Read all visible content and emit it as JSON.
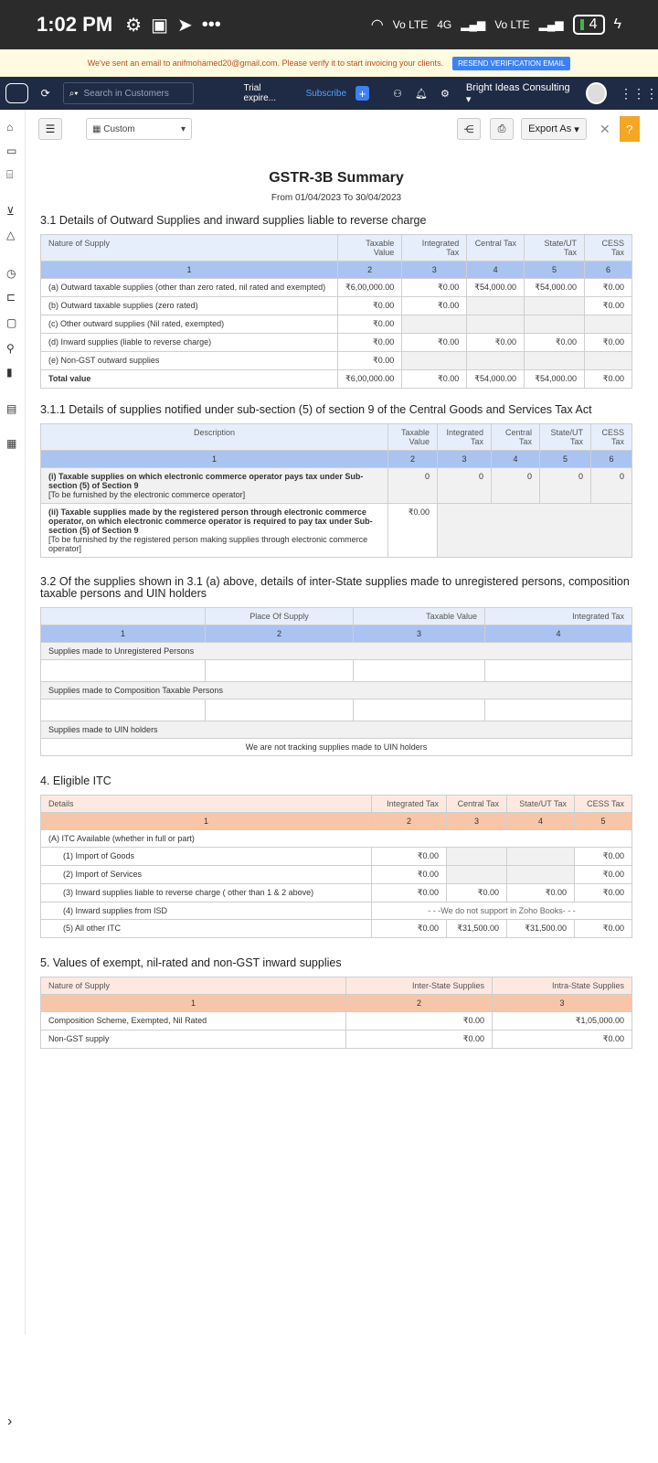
{
  "status": {
    "time": "1:02 PM",
    "network": "4G",
    "lte1": "Vo LTE",
    "lte2": "Vo LTE",
    "battery": "4"
  },
  "banner": {
    "message": "We've sent an email to anifmohamed20@gmail.com. Please verify it to start invoicing your clients.",
    "button": "RESEND VERIFICATION EMAIL"
  },
  "topnav": {
    "search_placeholder": "Search in Customers",
    "trial": "Trial expire...",
    "subscribe": "Subscribe",
    "org": "Bright Ideas Consulting"
  },
  "toolbar": {
    "range": "Custom",
    "export": "Export As",
    "help": "?"
  },
  "report": {
    "title": "GSTR-3B Summary",
    "period": "From 01/04/2023  To 30/04/2023"
  },
  "s31": {
    "heading": "3.1 Details of Outward Supplies and inward supplies liable to reverse charge",
    "cols": [
      "Nature of Supply",
      "Taxable Value",
      "Integrated Tax",
      "Central Tax",
      "State/UT Tax",
      "CESS Tax"
    ],
    "nums": [
      "1",
      "2",
      "3",
      "4",
      "5",
      "6"
    ],
    "rows": [
      [
        "(a) Outward taxable supplies (other than zero rated, nil rated and exempted)",
        "₹6,00,000.00",
        "₹0.00",
        "₹54,000.00",
        "₹54,000.00",
        "₹0.00"
      ],
      [
        "(b) Outward taxable supplies (zero rated)",
        "₹0.00",
        "₹0.00",
        "",
        "",
        "₹0.00"
      ],
      [
        "(c) Other outward supplies (Nil rated, exempted)",
        "₹0.00",
        "",
        "",
        "",
        ""
      ],
      [
        "(d) Inward supplies (liable to reverse charge)",
        "₹0.00",
        "₹0.00",
        "₹0.00",
        "₹0.00",
        "₹0.00"
      ],
      [
        "(e) Non-GST outward supplies",
        "₹0.00",
        "",
        "",
        "",
        ""
      ],
      [
        "Total value",
        "₹6,00,000.00",
        "₹0.00",
        "₹54,000.00",
        "₹54,000.00",
        "₹0.00"
      ]
    ]
  },
  "s311": {
    "heading": "3.1.1 Details of supplies notified under sub-section (5) of section 9 of the Central Goods and Services Tax Act",
    "cols": [
      "Description",
      "Taxable Value",
      "Integrated Tax",
      "Central Tax",
      "State/UT Tax",
      "CESS Tax"
    ],
    "nums": [
      "1",
      "2",
      "3",
      "4",
      "5",
      "6"
    ],
    "r1a": "(i) Taxable supplies on which electronic commerce operator pays tax under Sub-section (5) of Section 9",
    "r1b": "[To be furnished by the electronic commerce operator]",
    "r1v": [
      "0",
      "0",
      "0",
      "0",
      "0"
    ],
    "r2a": "(ii) Taxable supplies made by the registered person through electronic commerce operator, on which electronic commerce operator is required to pay tax under Sub-section (5) of Section 9",
    "r2b": "[To be furnished by the registered person making supplies through electronic commerce operator]",
    "r2v": "₹0.00"
  },
  "s32": {
    "heading": "3.2 Of the supplies shown in 3.1 (a) above, details of inter-State supplies made to unregistered persons, composition taxable persons and UIN holders",
    "cols": [
      "",
      "Place Of Supply",
      "Taxable Value",
      "Integrated Tax"
    ],
    "nums": [
      "1",
      "2",
      "3",
      "4"
    ],
    "g1": "Supplies made to Unregistered Persons",
    "g2": "Supplies made to Composition Taxable Persons",
    "g3": "Supplies made to UIN holders",
    "note": "We are not tracking supplies made to UIN holders"
  },
  "s4": {
    "heading": "4. Eligible ITC",
    "cols": [
      "Details",
      "Integrated Tax",
      "Central Tax",
      "State/UT Tax",
      "CESS Tax"
    ],
    "nums": [
      "1",
      "2",
      "3",
      "4",
      "5"
    ],
    "group": "(A) ITC Available (whether in full or part)",
    "rows": [
      [
        "(1) Import of Goods",
        "₹0.00",
        "",
        "",
        "₹0.00"
      ],
      [
        "(2) Import of Services",
        "₹0.00",
        "",
        "",
        "₹0.00"
      ],
      [
        "(3) Inward supplies liable to reverse charge ( other than 1 & 2 above)",
        "₹0.00",
        "₹0.00",
        "₹0.00",
        "₹0.00"
      ],
      [
        "(5) All other ITC",
        "₹0.00",
        "₹31,500.00",
        "₹31,500.00",
        "₹0.00"
      ]
    ],
    "isd_label": "(4) Inward supplies from ISD",
    "isd_note": "- - -We do not support in Zoho Books- - -"
  },
  "s5": {
    "heading": "5. Values of exempt, nil-rated and non-GST inward supplies",
    "cols": [
      "Nature of Supply",
      "Inter-State Supplies",
      "Intra-State Supplies"
    ],
    "nums": [
      "1",
      "2",
      "3"
    ],
    "rows": [
      [
        "Composition Scheme, Exempted, Nil Rated",
        "₹0.00",
        "₹1,05,000.00"
      ],
      [
        "Non-GST supply",
        "₹0.00",
        "₹0.00"
      ]
    ]
  }
}
